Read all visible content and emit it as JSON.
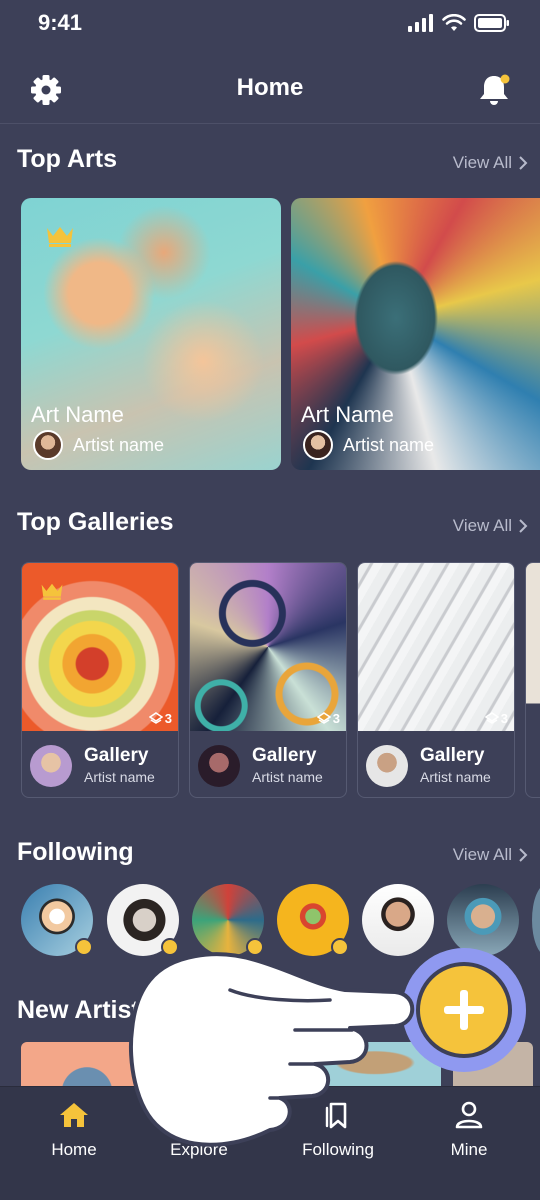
{
  "status": {
    "time": "9:41"
  },
  "header": {
    "title": "Home"
  },
  "sections": {
    "top_arts": {
      "title": "Top Arts",
      "view_all": "View All"
    },
    "top_galleries": {
      "title": "Top Galleries",
      "view_all": "View All"
    },
    "following": {
      "title": "Following",
      "view_all": "View All"
    },
    "new_artists": {
      "title": "New Artists"
    }
  },
  "top_arts": [
    {
      "name": "Art Name",
      "artist": "Artist name",
      "crowned": true
    },
    {
      "name": "Art Name",
      "artist": "Artist name",
      "crowned": false
    }
  ],
  "galleries": [
    {
      "name": "Gallery",
      "artist": "Artist name",
      "count": "3"
    },
    {
      "name": "Gallery",
      "artist": "Artist name",
      "count": "3"
    },
    {
      "name": "Gallery",
      "artist": "Artist name",
      "count": "3"
    }
  ],
  "following_users": [
    {
      "online": true
    },
    {
      "online": true
    },
    {
      "online": true
    },
    {
      "online": true
    },
    {
      "online": false
    },
    {
      "online": false
    }
  ],
  "tabs": [
    {
      "label": "Home",
      "icon": "home-icon",
      "active": true
    },
    {
      "label": "Explore",
      "icon": "search-icon",
      "active": false
    },
    {
      "label": "Following",
      "icon": "bookmark-icon",
      "active": false
    },
    {
      "label": "Mine",
      "icon": "user-icon",
      "active": false
    }
  ],
  "colors": {
    "background": "#3d4058",
    "accent": "#f5c33b",
    "fab_ring": "#8f99f0",
    "tabbar": "#33364a"
  }
}
